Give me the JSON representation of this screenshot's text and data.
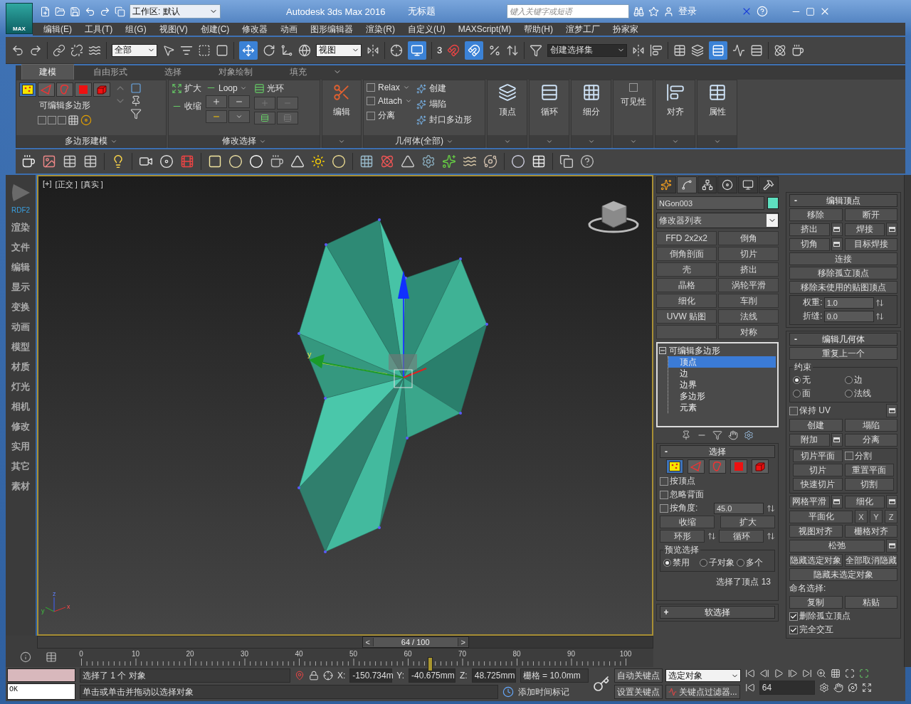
{
  "title_bar": {
    "logo": "MAX",
    "workspace": "工作区: 默认",
    "app_title": "Autodesk 3ds Max 2016",
    "document": "无标题",
    "search": {
      "placeholder": "键入关键字或短语"
    },
    "login": "登录"
  },
  "menu": [
    "编辑(E)",
    "工具(T)",
    "组(G)",
    "视图(V)",
    "创建(C)",
    "修改器",
    "动画",
    "图形编辑器",
    "渲染(R)",
    "自定义(U)",
    "MAXScript(M)",
    "帮助(H)",
    "渲梦工厂",
    "扮家家"
  ],
  "main_toolbar": {
    "selection_filter": "全部",
    "reference_coordinate": "视图",
    "snap_dimension": "3",
    "selection_set": "创建选择集"
  },
  "ribbon": {
    "tabs": [
      {
        "label": "建模",
        "selected": true
      },
      {
        "label": "自由形式",
        "selected": false
      },
      {
        "label": "选择",
        "selected": false
      },
      {
        "label": "对象绘制",
        "selected": false
      },
      {
        "label": "填充",
        "selected": false
      }
    ],
    "polygon_modeling": {
      "levels": [
        {
          "selected": true
        },
        {
          "selected": false
        },
        {
          "selected": false
        },
        {
          "selected": false
        },
        {
          "selected": false
        }
      ],
      "object_type": "可编辑多边形",
      "footer": "多边形建模"
    },
    "modify_selection": {
      "grow": "扩大",
      "shrink": "收缩",
      "loop": "Loop",
      "ring": "光环",
      "footer": "修改选择"
    },
    "edit": {
      "label": "编辑"
    },
    "geometry": {
      "items": [
        {
          "label": "Relax",
          "dropdown": true
        },
        {
          "label": "Attach",
          "dropdown": true
        },
        {
          "label": "分离",
          "dropdown": false
        },
        {
          "label": "创建",
          "dropdown": false
        },
        {
          "label": "塌陷",
          "dropdown": false
        },
        {
          "label": "封口多边形",
          "dropdown": false
        }
      ],
      "footer": "几何体(全部)"
    },
    "big_buttons": [
      "顶点",
      "循环",
      "细分",
      "可见性",
      "对齐",
      "属性"
    ]
  },
  "sidebar": {
    "badge": "RDF2",
    "items": [
      "渲染",
      "文件",
      "编辑",
      "显示",
      "变换",
      "动画",
      "模型",
      "材质",
      "灯光",
      "相机",
      "修改",
      "实用",
      "其它",
      "素材"
    ]
  },
  "viewport": {
    "labels": [
      "[+]",
      "[正交 ]",
      "[真实 ]"
    ],
    "gizmo_label": "y",
    "axis_labels": [
      "z",
      "y",
      "x"
    ]
  },
  "timeline": {
    "prev": "<",
    "position": "64 / 100",
    "next": ">",
    "level": 0.64,
    "ticks": [
      "0",
      "10",
      "20",
      "30",
      "40",
      "50",
      "60",
      "70",
      "80",
      "90",
      "100"
    ]
  },
  "command_panel": {
    "tabs": [
      {
        "selected": false
      },
      {
        "selected": true
      },
      {
        "selected": false
      },
      {
        "selected": false
      },
      {
        "selected": false
      },
      {
        "selected": false
      }
    ],
    "object": {
      "name": "NGon003",
      "color": "#5ee0c0"
    },
    "modifier_list": "修改器列表",
    "modifier_buttons": [
      {
        "left": "FFD 2x2x2",
        "right": "倒角"
      },
      {
        "left": "倒角剖面",
        "right": "切片"
      },
      {
        "left": "壳",
        "right": "挤出"
      },
      {
        "left": "晶格",
        "right": "涡轮平滑"
      },
      {
        "left": "细化",
        "right": "车削"
      },
      {
        "left": "UVW 贴图",
        "right": "法线"
      },
      {
        "right": "对称"
      }
    ],
    "stack": {
      "label": "可编辑多边形",
      "expanded": true,
      "children": [
        {
          "label": "顶点",
          "selected": true
        },
        {
          "label": "边",
          "selected": false
        },
        {
          "label": "边界",
          "selected": false
        },
        {
          "label": "多边形",
          "selected": false
        },
        {
          "label": "元素",
          "selected": false
        }
      ]
    },
    "selection": {
      "toggle": "-",
      "title": "选择",
      "levels": [
        {
          "selected": true
        },
        {
          "selected": false
        },
        {
          "selected": false
        },
        {
          "selected": false
        },
        {
          "selected": false
        }
      ],
      "checkboxes": [
        {
          "label": "按顶点",
          "checked": false
        },
        {
          "label": "忽略背面",
          "checked": false
        },
        {
          "label": "按角度:",
          "checked": false
        }
      ],
      "angle": "45.0",
      "shrink": "收缩",
      "grow": "扩大",
      "ring": "环形",
      "loop": "循环",
      "preview": {
        "title": "预览选择",
        "options": [
          {
            "label": "禁用",
            "selected": true
          },
          {
            "label": "子对象",
            "selected": false
          },
          {
            "label": "多个",
            "selected": false
          }
        ]
      },
      "status": "选择了顶点 13"
    },
    "soft_selection": {
      "toggle": "+",
      "title": "软选择"
    }
  },
  "right_panel": {
    "edit_vertices": {
      "toggle": "-",
      "title": "编辑顶点",
      "rows": [
        {
          "kind": "row",
          "items": [
            {
              "kind": "button",
              "label": "移除",
              "settings": false
            },
            {
              "kind": "button",
              "label": "断开",
              "settings": false
            }
          ]
        },
        {
          "kind": "row",
          "items": [
            {
              "kind": "button",
              "label": "挤出",
              "settings": true
            },
            {
              "kind": "button",
              "label": "焊接",
              "settings": true
            }
          ]
        },
        {
          "kind": "row",
          "items": [
            {
              "kind": "button",
              "label": "切角",
              "settings": true
            },
            {
              "kind": "button",
              "label": "目标焊接",
              "settings": false
            }
          ]
        },
        {
          "kind": "row",
          "items": [
            {
              "kind": "button",
              "label": "连接",
              "settings": false
            }
          ]
        },
        {
          "kind": "row",
          "items": [
            {
              "kind": "button",
              "label": "移除孤立顶点",
              "settings": false
            }
          ]
        },
        {
          "kind": "row",
          "items": [
            {
              "kind": "button",
              "label": "移除未使用的贴图顶点",
              "settings": false
            }
          ]
        },
        {
          "kind": "group",
          "rows": [
            {
              "kind": "row",
              "items": [
                {
                  "kind": "spinner",
                  "label": "权重:",
                  "value": "1.0"
                }
              ]
            },
            {
              "kind": "row",
              "items": [
                {
                  "kind": "spinner",
                  "label": "折缝:",
                  "value": "0.0"
                }
              ]
            }
          ]
        }
      ]
    },
    "edit_geometry": {
      "toggle": "-",
      "title": "编辑几何体",
      "rows": [
        {
          "kind": "row",
          "items": [
            {
              "kind": "button",
              "label": "重复上一个",
              "settings": false
            }
          ]
        },
        {
          "kind": "group",
          "title": "约束",
          "rows": [
            {
              "kind": "row",
              "items": [
                {
                  "kind": "radio",
                  "label": "无",
                  "selected": true
                },
                {
                  "kind": "radio",
                  "label": "边",
                  "selected": false
                }
              ]
            },
            {
              "kind": "row",
              "items": [
                {
                  "kind": "radio",
                  "label": "面",
                  "selected": false
                },
                {
                  "kind": "radio",
                  "label": "法线",
                  "selected": false
                }
              ]
            }
          ]
        },
        {
          "kind": "row",
          "items": [
            {
              "kind": "check",
              "label": "保持 UV",
              "checked": false
            },
            {
              "kind": "settings"
            }
          ]
        },
        {
          "kind": "row",
          "items": [
            {
              "kind": "button",
              "label": "创建",
              "settings": false
            },
            {
              "kind": "button",
              "label": "塌陷",
              "settings": false
            }
          ]
        },
        {
          "kind": "row",
          "items": [
            {
              "kind": "button",
              "label": "附加",
              "settings": true
            },
            {
              "kind": "button",
              "label": "分离",
              "settings": false
            }
          ]
        },
        {
          "kind": "group",
          "rows": [
            {
              "kind": "row",
              "items": [
                {
                  "kind": "button",
                  "label": "切片平面",
                  "settings": false
                },
                {
                  "kind": "check",
                  "label": "分割",
                  "checked": false
                }
              ]
            },
            {
              "kind": "row",
              "items": [
                {
                  "kind": "button",
                  "label": "切片",
                  "settings": false
                },
                {
                  "kind": "button",
                  "label": "重置平面",
                  "settings": false
                }
              ]
            },
            {
              "kind": "row",
              "items": [
                {
                  "kind": "button",
                  "label": "快速切片",
                  "settings": false
                },
                {
                  "kind": "button",
                  "label": "切割",
                  "settings": false
                }
              ]
            }
          ]
        },
        {
          "kind": "row",
          "items": [
            {
              "kind": "button",
              "label": "网格平滑",
              "settings": true
            },
            {
              "kind": "button",
              "label": "细化",
              "settings": true
            }
          ]
        },
        {
          "kind": "row",
          "items": [
            {
              "kind": "button",
              "label": "平面化",
              "settings": false
            },
            {
              "kind": "axis",
              "label": "X"
            },
            {
              "kind": "axis",
              "label": "Y"
            },
            {
              "kind": "axis",
              "label": "Z"
            }
          ]
        },
        {
          "kind": "row",
          "items": [
            {
              "kind": "button",
              "label": "视图对齐",
              "settings": false
            },
            {
              "kind": "button",
              "label": "栅格对齐",
              "settings": false
            }
          ]
        },
        {
          "kind": "row",
          "items": [
            {
              "kind": "button",
              "label": "松弛",
              "settings": true
            }
          ]
        },
        {
          "kind": "row",
          "items": [
            {
              "kind": "button",
              "label": "隐藏选定对象",
              "settings": false
            },
            {
              "kind": "button",
              "label": "全部取消隐藏",
              "settings": false
            }
          ]
        },
        {
          "kind": "row",
          "items": [
            {
              "kind": "button",
              "label": "隐藏未选定对象",
              "settings": false
            }
          ]
        },
        {
          "kind": "label",
          "label": "命名选择:"
        },
        {
          "kind": "row",
          "items": [
            {
              "kind": "button",
              "label": "复制",
              "settings": false
            },
            {
              "kind": "button",
              "label": "粘贴",
              "settings": false
            }
          ]
        },
        {
          "kind": "row",
          "items": [
            {
              "kind": "check",
              "label": "删除孤立顶点",
              "checked": true
            }
          ]
        },
        {
          "kind": "row",
          "items": [
            {
              "kind": "check",
              "label": "完全交互",
              "checked": true
            }
          ]
        }
      ]
    }
  },
  "status_bar": {
    "listener_output": "OK",
    "selection_status": "选择了 1 个 对象",
    "prompt": "单击或单击并拖动以选择对象",
    "x_label": "X:",
    "x": "-150.734m",
    "y_label": "Y:",
    "y": "-40.675mm",
    "z_label": "Z:",
    "z": "48.725mm",
    "grid": "栅格 = 10.0mm",
    "add_time_tag": "添加时间标记",
    "auto_key": "自动关键点",
    "key_mode": "选定对象",
    "set_key": "设置关键点",
    "key_filters": "关键点过滤器...",
    "frame": "64"
  }
}
